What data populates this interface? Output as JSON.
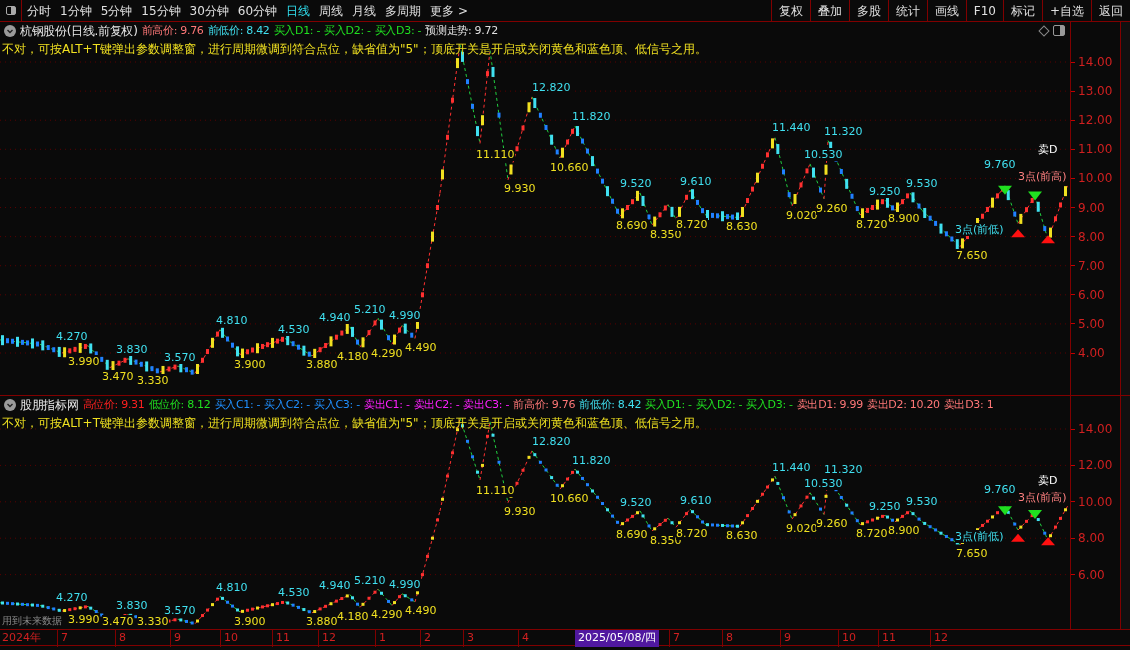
{
  "toolbar": {
    "periods": [
      {
        "label": "分时",
        "selected": false
      },
      {
        "label": "1分钟",
        "selected": false
      },
      {
        "label": "5分钟",
        "selected": false
      },
      {
        "label": "15分钟",
        "selected": false
      },
      {
        "label": "30分钟",
        "selected": false
      },
      {
        "label": "60分钟",
        "selected": false
      },
      {
        "label": "日线",
        "selected": true
      },
      {
        "label": "周线",
        "selected": false
      },
      {
        "label": "月线",
        "selected": false
      },
      {
        "label": "多周期",
        "selected": false
      },
      {
        "label": "更多 >",
        "selected": false
      }
    ],
    "buttons": [
      "复权",
      "叠加",
      "多股",
      "统计",
      "画线",
      "F10",
      "标记",
      "+自选",
      "返回"
    ]
  },
  "panes": [
    {
      "title": "杭钢股份(日线.前复权)",
      "indicators": [
        {
          "text": "前高价: 9.76",
          "color": "#ff7878"
        },
        {
          "text": "前低价: 8.42",
          "color": "#40e0f0"
        },
        {
          "text": "买入D1: -",
          "color": "#20e020"
        },
        {
          "text": "买入D2: -",
          "color": "#20e020"
        },
        {
          "text": "买入D3: -",
          "color": "#20e020"
        },
        {
          "text": "预测走势: 9.72",
          "color": "#e0e0e0"
        }
      ],
      "note": "不对，可按ALT+T键弹出参数调整窗，进行周期微调到符合点位，缺省值为\"5\"；顶底开关是开启或关闭黄色和蓝色顶、低信号之用。",
      "y_ticks": [
        "14.00",
        "13.00",
        "12.00",
        "11.00",
        "10.00",
        "9.00",
        "8.00",
        "7.00",
        "6.00",
        "5.00",
        "4.00"
      ],
      "labels": [
        {
          "text": "4.270",
          "kind": "high"
        },
        {
          "text": "3.990",
          "kind": "low"
        },
        {
          "text": "3.830",
          "kind": "high"
        },
        {
          "text": "3.470",
          "kind": "low"
        },
        {
          "text": "3.570",
          "kind": "high"
        },
        {
          "text": "3.330",
          "kind": "low"
        },
        {
          "text": "4.810",
          "kind": "high"
        },
        {
          "text": "3.900",
          "kind": "low"
        },
        {
          "text": "4.530",
          "kind": "high"
        },
        {
          "text": "3.880",
          "kind": "low"
        },
        {
          "text": "4.940",
          "kind": "high"
        },
        {
          "text": "4.180",
          "kind": "low"
        },
        {
          "text": "5.210",
          "kind": "high"
        },
        {
          "text": "4.290",
          "kind": "low"
        },
        {
          "text": "4.990",
          "kind": "high"
        },
        {
          "text": "4.490",
          "kind": "low"
        },
        {
          "text": "11.110",
          "kind": "low"
        },
        {
          "text": "9.930",
          "kind": "low"
        },
        {
          "text": "12.820",
          "kind": "high"
        },
        {
          "text": "10.660",
          "kind": "low"
        },
        {
          "text": "11.820",
          "kind": "high"
        },
        {
          "text": "8.690",
          "kind": "low"
        },
        {
          "text": "9.520",
          "kind": "high"
        },
        {
          "text": "8.350",
          "kind": "low"
        },
        {
          "text": "9.610",
          "kind": "high"
        },
        {
          "text": "8.720",
          "kind": "low"
        },
        {
          "text": "8.630",
          "kind": "low"
        },
        {
          "text": "11.440",
          "kind": "high"
        },
        {
          "text": "9.020",
          "kind": "low"
        },
        {
          "text": "10.530",
          "kind": "high"
        },
        {
          "text": "11.320",
          "kind": "high"
        },
        {
          "text": "9.260",
          "kind": "low"
        },
        {
          "text": "8.720",
          "kind": "low"
        },
        {
          "text": "9.250",
          "kind": "high"
        },
        {
          "text": "8.900",
          "kind": "low"
        },
        {
          "text": "9.530",
          "kind": "high"
        },
        {
          "text": "7.650",
          "kind": "low"
        },
        {
          "text": "9.760",
          "kind": "high"
        },
        {
          "text": "3点(前高)",
          "kind": "note_high"
        },
        {
          "text": "3点(前低)",
          "kind": "note_low"
        },
        {
          "text": "卖D",
          "kind": "signal"
        }
      ]
    },
    {
      "title": "股朋指标网",
      "indicators": [
        {
          "text": "高位价: 9.31",
          "color": "#ff2020"
        },
        {
          "text": "低位价: 8.12",
          "color": "#20e020"
        },
        {
          "text": "买入C1: -",
          "color": "#2090ff"
        },
        {
          "text": "买入C2: -",
          "color": "#2090ff"
        },
        {
          "text": "买入C3: -",
          "color": "#2090ff"
        },
        {
          "text": "卖出C1: -",
          "color": "#ff20ff"
        },
        {
          "text": "卖出C2: -",
          "color": "#ff20ff"
        },
        {
          "text": "卖出C3: -",
          "color": "#ff20ff"
        },
        {
          "text": "前高价: 9.76",
          "color": "#ff7878"
        },
        {
          "text": "前低价: 8.42",
          "color": "#40e0f0"
        },
        {
          "text": "买入D1: -",
          "color": "#20e020"
        },
        {
          "text": "买入D2: -",
          "color": "#20e020"
        },
        {
          "text": "买入D3: -",
          "color": "#20e020"
        },
        {
          "text": "卖出D1: 9.99",
          "color": "#ff7878"
        },
        {
          "text": "卖出D2: 10.20",
          "color": "#ff7878"
        },
        {
          "text": "卖出D3: 1",
          "color": "#ff7878"
        }
      ],
      "note": "不对，可按ALT+T键弹出参数调整窗，进行周期微调到符合点位，缺省值为\"5\"；顶底开关是开启或关闭黄色和蓝色顶、低信号之用。",
      "y_ticks": [
        "14.00",
        "12.00",
        "10.00",
        "8.00",
        "6.00"
      ],
      "footnote": "用到未来数据",
      "labels": [
        {
          "text": "4.270",
          "kind": "high"
        },
        {
          "text": "3.990",
          "kind": "low"
        },
        {
          "text": "3.830",
          "kind": "high"
        },
        {
          "text": "3.470",
          "kind": "low"
        },
        {
          "text": "3.570",
          "kind": "high"
        },
        {
          "text": "3.330",
          "kind": "low"
        },
        {
          "text": "4.810",
          "kind": "high"
        },
        {
          "text": "3.900",
          "kind": "low"
        },
        {
          "text": "4.530",
          "kind": "high"
        },
        {
          "text": "3.880",
          "kind": "low"
        },
        {
          "text": "4.940",
          "kind": "high"
        },
        {
          "text": "4.180",
          "kind": "low"
        },
        {
          "text": "5.210",
          "kind": "high"
        },
        {
          "text": "4.290",
          "kind": "low"
        },
        {
          "text": "4.990",
          "kind": "high"
        },
        {
          "text": "4.490",
          "kind": "low"
        },
        {
          "text": "11.110",
          "kind": "low"
        },
        {
          "text": "9.930",
          "kind": "low"
        },
        {
          "text": "12.820",
          "kind": "high"
        },
        {
          "text": "10.660",
          "kind": "low"
        },
        {
          "text": "11.820",
          "kind": "high"
        },
        {
          "text": "8.690",
          "kind": "low"
        },
        {
          "text": "9.520",
          "kind": "high"
        },
        {
          "text": "8.350",
          "kind": "low"
        },
        {
          "text": "9.610",
          "kind": "high"
        },
        {
          "text": "8.720",
          "kind": "low"
        },
        {
          "text": "8.630",
          "kind": "low"
        },
        {
          "text": "11.440",
          "kind": "high"
        },
        {
          "text": "9.020",
          "kind": "low"
        },
        {
          "text": "10.530",
          "kind": "high"
        },
        {
          "text": "11.320",
          "kind": "high"
        },
        {
          "text": "9.260",
          "kind": "low"
        },
        {
          "text": "8.720",
          "kind": "low"
        },
        {
          "text": "9.250",
          "kind": "high"
        },
        {
          "text": "8.900",
          "kind": "low"
        },
        {
          "text": "9.530",
          "kind": "high"
        },
        {
          "text": "7.650",
          "kind": "low"
        },
        {
          "text": "9.760",
          "kind": "high"
        },
        {
          "text": "3点(前高)",
          "kind": "note_high"
        },
        {
          "text": "3点(前低)",
          "kind": "note_low"
        },
        {
          "text": "卖D",
          "kind": "signal"
        }
      ]
    }
  ],
  "time_axis": {
    "year": "2024年",
    "months_before": [
      "7",
      "8",
      "9",
      "10",
      "11",
      "12",
      "1",
      "2",
      "3",
      "4"
    ],
    "cursor_date": "2025/05/08/四",
    "months_after": [
      "7",
      "8",
      "9",
      "10",
      "11",
      "12"
    ]
  }
}
